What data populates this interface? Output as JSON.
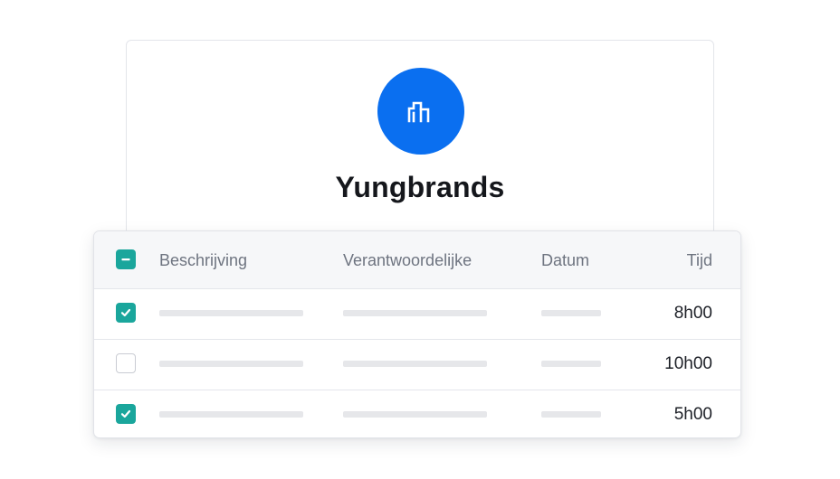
{
  "company": {
    "name": "Yungbrands",
    "avatar_icon": "buildings-icon",
    "accent_color": "#0a6ff0"
  },
  "table": {
    "accent_color": "#1aa69c",
    "select_all_state": "indeterminate",
    "columns": {
      "description": "Beschrijving",
      "responsible": "Verantwoordelijke",
      "date": "Datum",
      "time": "Tijd"
    },
    "rows": [
      {
        "checked": true,
        "time": "8h00"
      },
      {
        "checked": false,
        "time": "10h00"
      },
      {
        "checked": true,
        "time": "5h00"
      }
    ]
  }
}
